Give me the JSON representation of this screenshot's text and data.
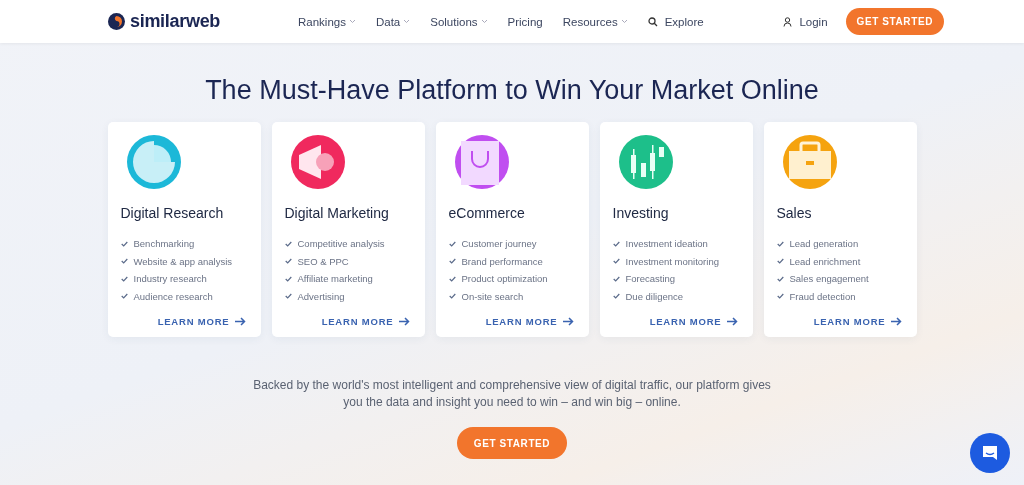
{
  "header": {
    "logo": "similarweb",
    "nav": [
      {
        "label": "Rankings",
        "dropdown": true
      },
      {
        "label": "Data",
        "dropdown": true
      },
      {
        "label": "Solutions",
        "dropdown": true
      },
      {
        "label": "Pricing",
        "dropdown": false
      },
      {
        "label": "Resources",
        "dropdown": true
      }
    ],
    "explore": "Explore",
    "login": "Login",
    "cta": "GET STARTED"
  },
  "headline": "The Must-Have Platform to Win Your Market Online",
  "cards": [
    {
      "kind": "pie",
      "color": "#1cb8d8",
      "title": "Digital Research",
      "features": [
        "Benchmarking",
        "Website & app analysis",
        "Industry research",
        "Audience research"
      ],
      "link": "LEARN MORE"
    },
    {
      "kind": "megaphone",
      "color": "#f0295e",
      "title": "Digital Marketing",
      "features": [
        "Competitive analysis",
        "SEO & PPC",
        "Affiliate marketing",
        "Advertising"
      ],
      "link": "LEARN MORE"
    },
    {
      "kind": "bag",
      "color": "#c04ef0",
      "title": "eCommerce",
      "features": [
        "Customer journey",
        "Brand performance",
        "Product optimization",
        "On-site search"
      ],
      "link": "LEARN MORE"
    },
    {
      "kind": "candles",
      "color": "#1dbf8a",
      "title": "Investing",
      "features": [
        "Investment ideation",
        "Investment monitoring",
        "Forecasting",
        "Due diligence"
      ],
      "link": "LEARN MORE"
    },
    {
      "kind": "briefcase",
      "color": "#f5a30f",
      "title": "Sales",
      "features": [
        "Lead generation",
        "Lead enrichment",
        "Sales engagement",
        "Fraud detection"
      ],
      "link": "LEARN MORE"
    }
  ],
  "blurb": "Backed by the world's most intelligent and comprehensive view of digital traffic, our platform gives you the data and insight you need to win – and win big – online.",
  "cta": "GET STARTED"
}
